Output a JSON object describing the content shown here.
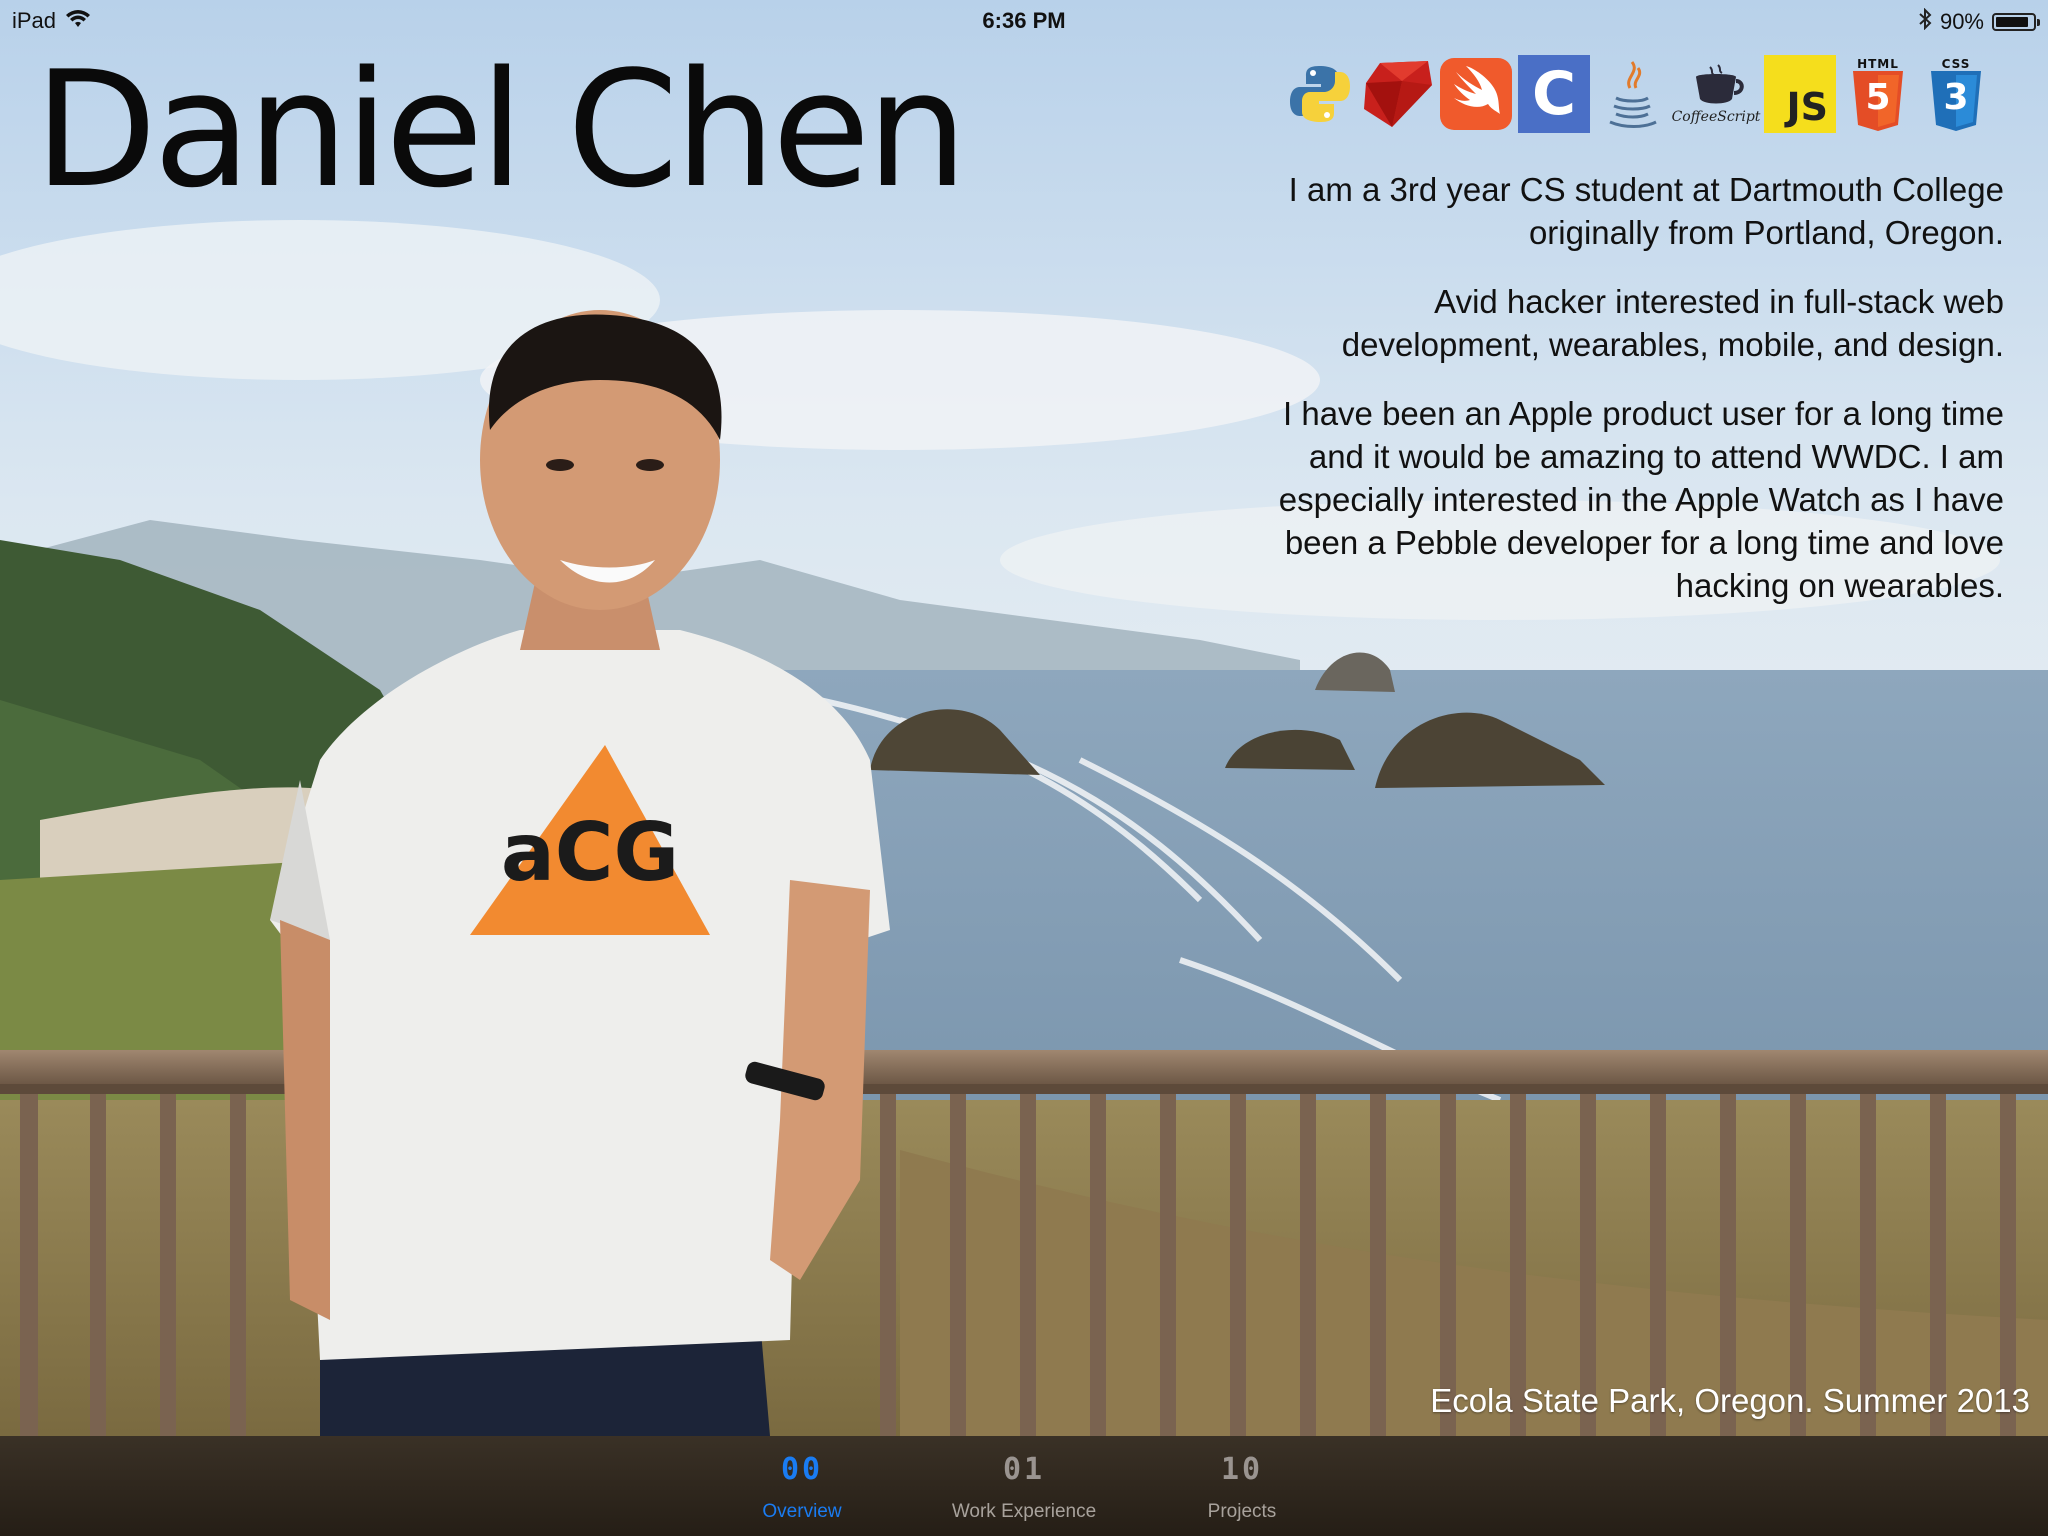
{
  "status_bar": {
    "device": "iPad",
    "time": "6:36 PM",
    "battery_percent_label": "90%",
    "battery_level": 0.9
  },
  "profile": {
    "name": "Daniel Chen",
    "bio": [
      "I am a 3rd year CS student at Dartmouth College originally from Portland, Oregon.",
      "Avid hacker interested in full-stack web development, wearables, mobile, and design.",
      "I have been an Apple product user for a long time and it would be amazing to attend WWDC. I am especially interested in the Apple Watch as I have been a Pebble developer for a long time and love hacking on wearables."
    ],
    "photo_caption": "Ecola State Park, Oregon. Summer 2013",
    "shirt_logo": "aCG"
  },
  "skills": {
    "ruby_label": "",
    "c_label": "C",
    "coffeescript_label": "CoffeeScript",
    "js_label": "JS",
    "html_label": "HTML",
    "html_num": "5",
    "css_label": "CSS",
    "css_num": "3"
  },
  "tabs": [
    {
      "num": "00",
      "label": "Overview",
      "active": true
    },
    {
      "num": "01",
      "label": "Work Experience",
      "active": false
    },
    {
      "num": "10",
      "label": "Projects",
      "active": false
    }
  ],
  "colors": {
    "accent": "#1a7cf2",
    "tabbar_bg": "#2e261d",
    "python_blue": "#3b73a8",
    "python_yellow": "#f6d13b",
    "ruby_red": "#c8201c",
    "swift_orange": "#f05a2c",
    "c_blue": "#4a6fc6",
    "js_yellow": "#f5de1c",
    "html_orange": "#e44d26",
    "css_blue": "#1f6fb8",
    "shirt_orange": "#f28a30"
  }
}
